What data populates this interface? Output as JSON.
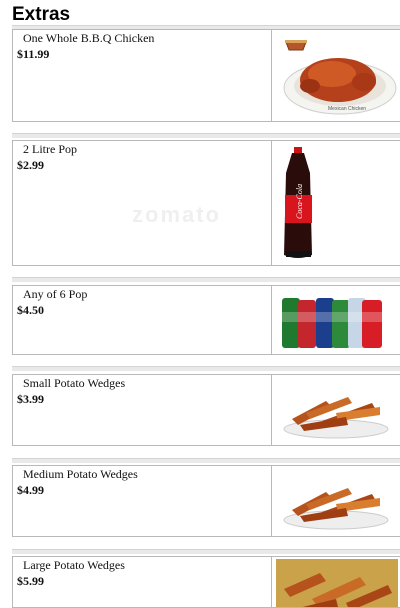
{
  "page": {
    "title": "Extras"
  },
  "items": [
    {
      "name": "One Whole B.B.Q Chicken",
      "price": "$11.99",
      "image": "bbq-chicken-photo"
    },
    {
      "name": "2 Litre Pop",
      "price": "$2.99",
      "image": "coca-cola-bottle-photo"
    },
    {
      "name": "Any of 6 Pop",
      "price": "$4.50",
      "image": "soda-cans-photo"
    },
    {
      "name": "Small Potato Wedges",
      "price": "$3.99",
      "image": "potato-wedges-photo"
    },
    {
      "name": "Medium Potato Wedges",
      "price": "$4.99",
      "image": "potato-wedges-photo"
    },
    {
      "name": "Large Potato Wedges",
      "price": "$5.99",
      "image": "potato-wedges-photo"
    }
  ],
  "watermark": "zomato"
}
